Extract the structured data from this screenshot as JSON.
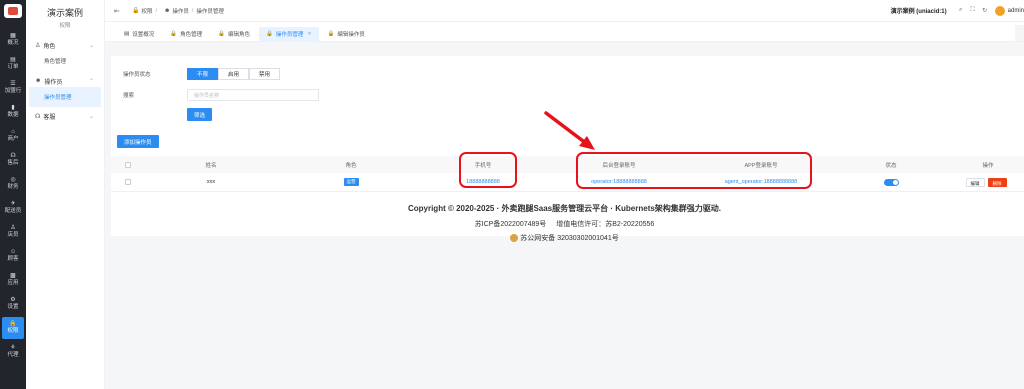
{
  "leftnav": {
    "items": [
      {
        "icon": "dashboard-icon",
        "glyph": "▦",
        "label": "概况"
      },
      {
        "icon": "order-icon",
        "glyph": "▤",
        "label": "订单"
      },
      {
        "icon": "dispatch-icon",
        "glyph": "☰",
        "label": "加盟行"
      },
      {
        "icon": "data-icon",
        "glyph": "▮",
        "label": "数据"
      },
      {
        "icon": "merchant-icon",
        "glyph": "⌂",
        "label": "商户"
      },
      {
        "icon": "headset-icon",
        "glyph": "☊",
        "label": "售后"
      },
      {
        "icon": "finance-icon",
        "glyph": "◎",
        "label": "财务"
      },
      {
        "icon": "delivery-icon",
        "glyph": "✈",
        "label": "配送员"
      },
      {
        "icon": "shop-icon",
        "glyph": "♙",
        "label": "店员"
      },
      {
        "icon": "customer-icon",
        "glyph": "☺",
        "label": "顾客"
      },
      {
        "icon": "apps-icon",
        "glyph": "▩",
        "label": "应用"
      },
      {
        "icon": "settings-icon",
        "glyph": "⚙",
        "label": "设置"
      },
      {
        "icon": "lock-icon",
        "glyph": "🔒",
        "label": "权限"
      },
      {
        "icon": "agent-icon",
        "glyph": "⚘",
        "label": "代理"
      }
    ]
  },
  "subnav": {
    "brand": "演示案例",
    "section": "权限",
    "groups": [
      {
        "label": "角色",
        "icon": "role-icon",
        "glyph": "♙",
        "items": [
          "角色管理"
        ]
      },
      {
        "label": "操作员",
        "icon": "operator-icon",
        "glyph": "☻",
        "items": [
          "操作员管理"
        ]
      },
      {
        "label": "客服",
        "icon": "service-icon",
        "glyph": "☊",
        "items": []
      }
    ]
  },
  "header": {
    "breadcrumb": [
      "权限",
      "操作员",
      "操作员管理"
    ],
    "store": "演示案例 (uniacid:1)",
    "user": "admin"
  },
  "tabs": [
    {
      "label": "设置概况",
      "active": false
    },
    {
      "label": "角色管理",
      "active": false
    },
    {
      "label": "编辑角色",
      "active": false
    },
    {
      "label": "操作员管理",
      "active": true
    },
    {
      "label": "编辑操作员",
      "active": false
    }
  ],
  "filters": {
    "status_label": "操作员状态",
    "status_options": [
      "不限",
      "启用",
      "禁用"
    ],
    "search_label": "搜索",
    "search_placeholder": "操作员名称",
    "filter_button": "筛选",
    "add_button": "添加操作员"
  },
  "table": {
    "columns": [
      "姓名",
      "角色",
      "手机号",
      "后台登录账号",
      "APP登录账号",
      "状态",
      "操作"
    ],
    "rows": [
      {
        "name": "xxx",
        "role": "运营",
        "phone": "18888888888",
        "backend_account": "operator:18888888888",
        "app_account": "agent_operator:18888888888",
        "status_on": true,
        "edit": "编辑",
        "delete": "删除"
      }
    ]
  },
  "footer": {
    "copyright": "Copyright © 2020-2025 · 外卖跑腿Saas服务管理云平台 · Kubernets架构集群强力驱动.",
    "icp": "苏ICP备2022007489号",
    "license": "增值电信许可：苏B2-20220556",
    "police": "苏公网安备 32030302001041号"
  },
  "colors": {
    "accent": "#2d8cf0",
    "annotation": "#e8121b",
    "nav_bg": "#22252b"
  }
}
